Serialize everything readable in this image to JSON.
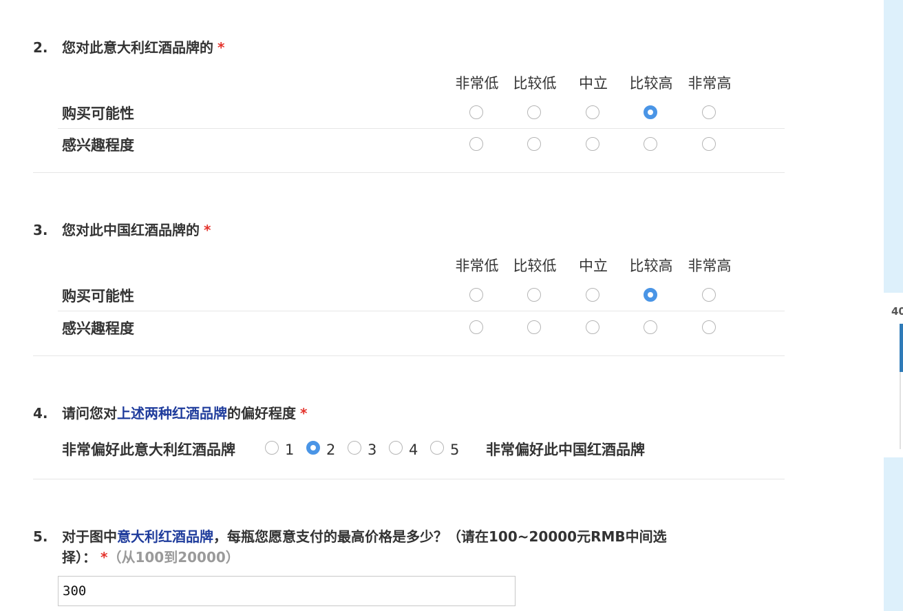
{
  "scale_labels": [
    "非常低",
    "比较低",
    "中立",
    "比较高",
    "非常高"
  ],
  "required_mark": "*",
  "q2": {
    "num": "2.",
    "title": "您对此意大利红酒品牌的",
    "rows": [
      {
        "label": "购买可能性",
        "selected_index": 3
      },
      {
        "label": "感兴趣程度",
        "selected_index": null
      }
    ]
  },
  "q3": {
    "num": "3.",
    "title": "您对此中国红酒品牌的",
    "rows": [
      {
        "label": "购买可能性",
        "selected_index": 3
      },
      {
        "label": "感兴趣程度",
        "selected_index": null
      }
    ]
  },
  "q4": {
    "num": "4.",
    "title_prefix": "请问您对",
    "title_highlight": "上述两种红酒品牌",
    "title_suffix": "的偏好程度",
    "left_anchor": "非常偏好此意大利红酒品牌",
    "right_anchor": "非常偏好此中国红酒品牌",
    "options": [
      "1",
      "2",
      "3",
      "4",
      "5"
    ],
    "selected_index": 1
  },
  "q5": {
    "num": "5.",
    "line1_prefix": "对于图中",
    "line1_highlight": "意大利红酒品牌",
    "line1_suffix": "，每瓶您愿意支付的最高价格是多少？（请在100~20000元RMB中间选",
    "line2": "择）：",
    "range_hint": "（从100到20000）",
    "value": "300"
  },
  "side": {
    "badge": "40"
  },
  "colors": {
    "accent": "#4a95e6",
    "required": "#e4332c",
    "highlight": "#1f3c9c",
    "side_panel": "#ddf0fb"
  }
}
